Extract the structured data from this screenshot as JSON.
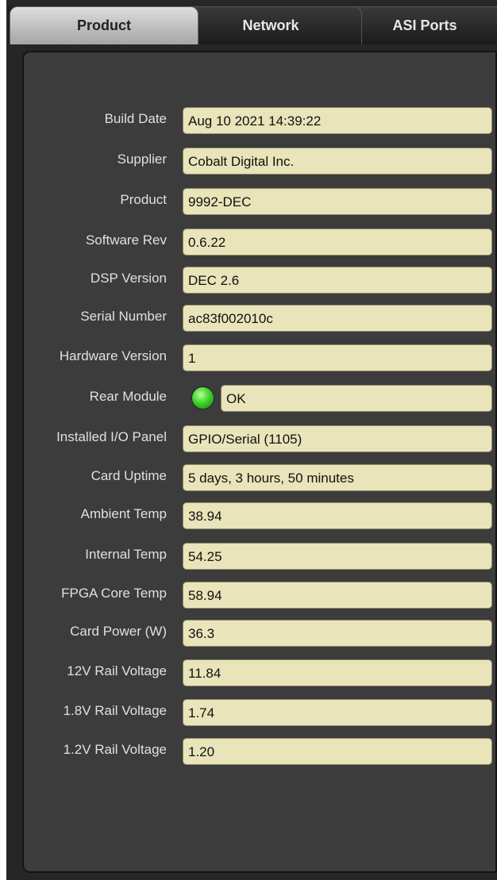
{
  "tabs": [
    {
      "label": "Product",
      "active": true
    },
    {
      "label": "Network",
      "active": false
    },
    {
      "label": "ASI Ports",
      "active": false
    }
  ],
  "fields": [
    {
      "label": "Build Date",
      "value": "Aug 10 2021 14:39:22"
    },
    {
      "label": "Supplier",
      "value": "Cobalt Digital Inc."
    },
    {
      "label": "Product",
      "value": "9992-DEC"
    },
    {
      "label": "Software Rev",
      "value": "0.6.22"
    },
    {
      "label": "DSP Version",
      "value": "DEC 2.6"
    },
    {
      "label": "Serial Number",
      "value": "ac83f002010c"
    },
    {
      "label": "Hardware Version",
      "value": "1"
    },
    {
      "label": "Rear Module",
      "value": "OK",
      "indicator": "green-led-icon"
    },
    {
      "label": "Installed I/O Panel",
      "value": "GPIO/Serial (1105)"
    },
    {
      "label": "Card Uptime",
      "value": "5 days, 3 hours, 50 minutes"
    },
    {
      "label": "Ambient Temp",
      "value": "38.94"
    },
    {
      "label": "Internal Temp",
      "value": "54.25"
    },
    {
      "label": "FPGA Core Temp",
      "value": "58.94"
    },
    {
      "label": "Card Power (W)",
      "value": "36.3"
    },
    {
      "label": "12V Rail Voltage",
      "value": "11.84"
    },
    {
      "label": "1.8V Rail Voltage",
      "value": "1.74"
    },
    {
      "label": "1.2V Rail Voltage",
      "value": "1.20"
    }
  ],
  "colors": {
    "field_background": "#e9e4b9",
    "panel_background": "#3c3c3c",
    "label_text": "#e0e0e0",
    "led_green": "#3fd42a"
  }
}
